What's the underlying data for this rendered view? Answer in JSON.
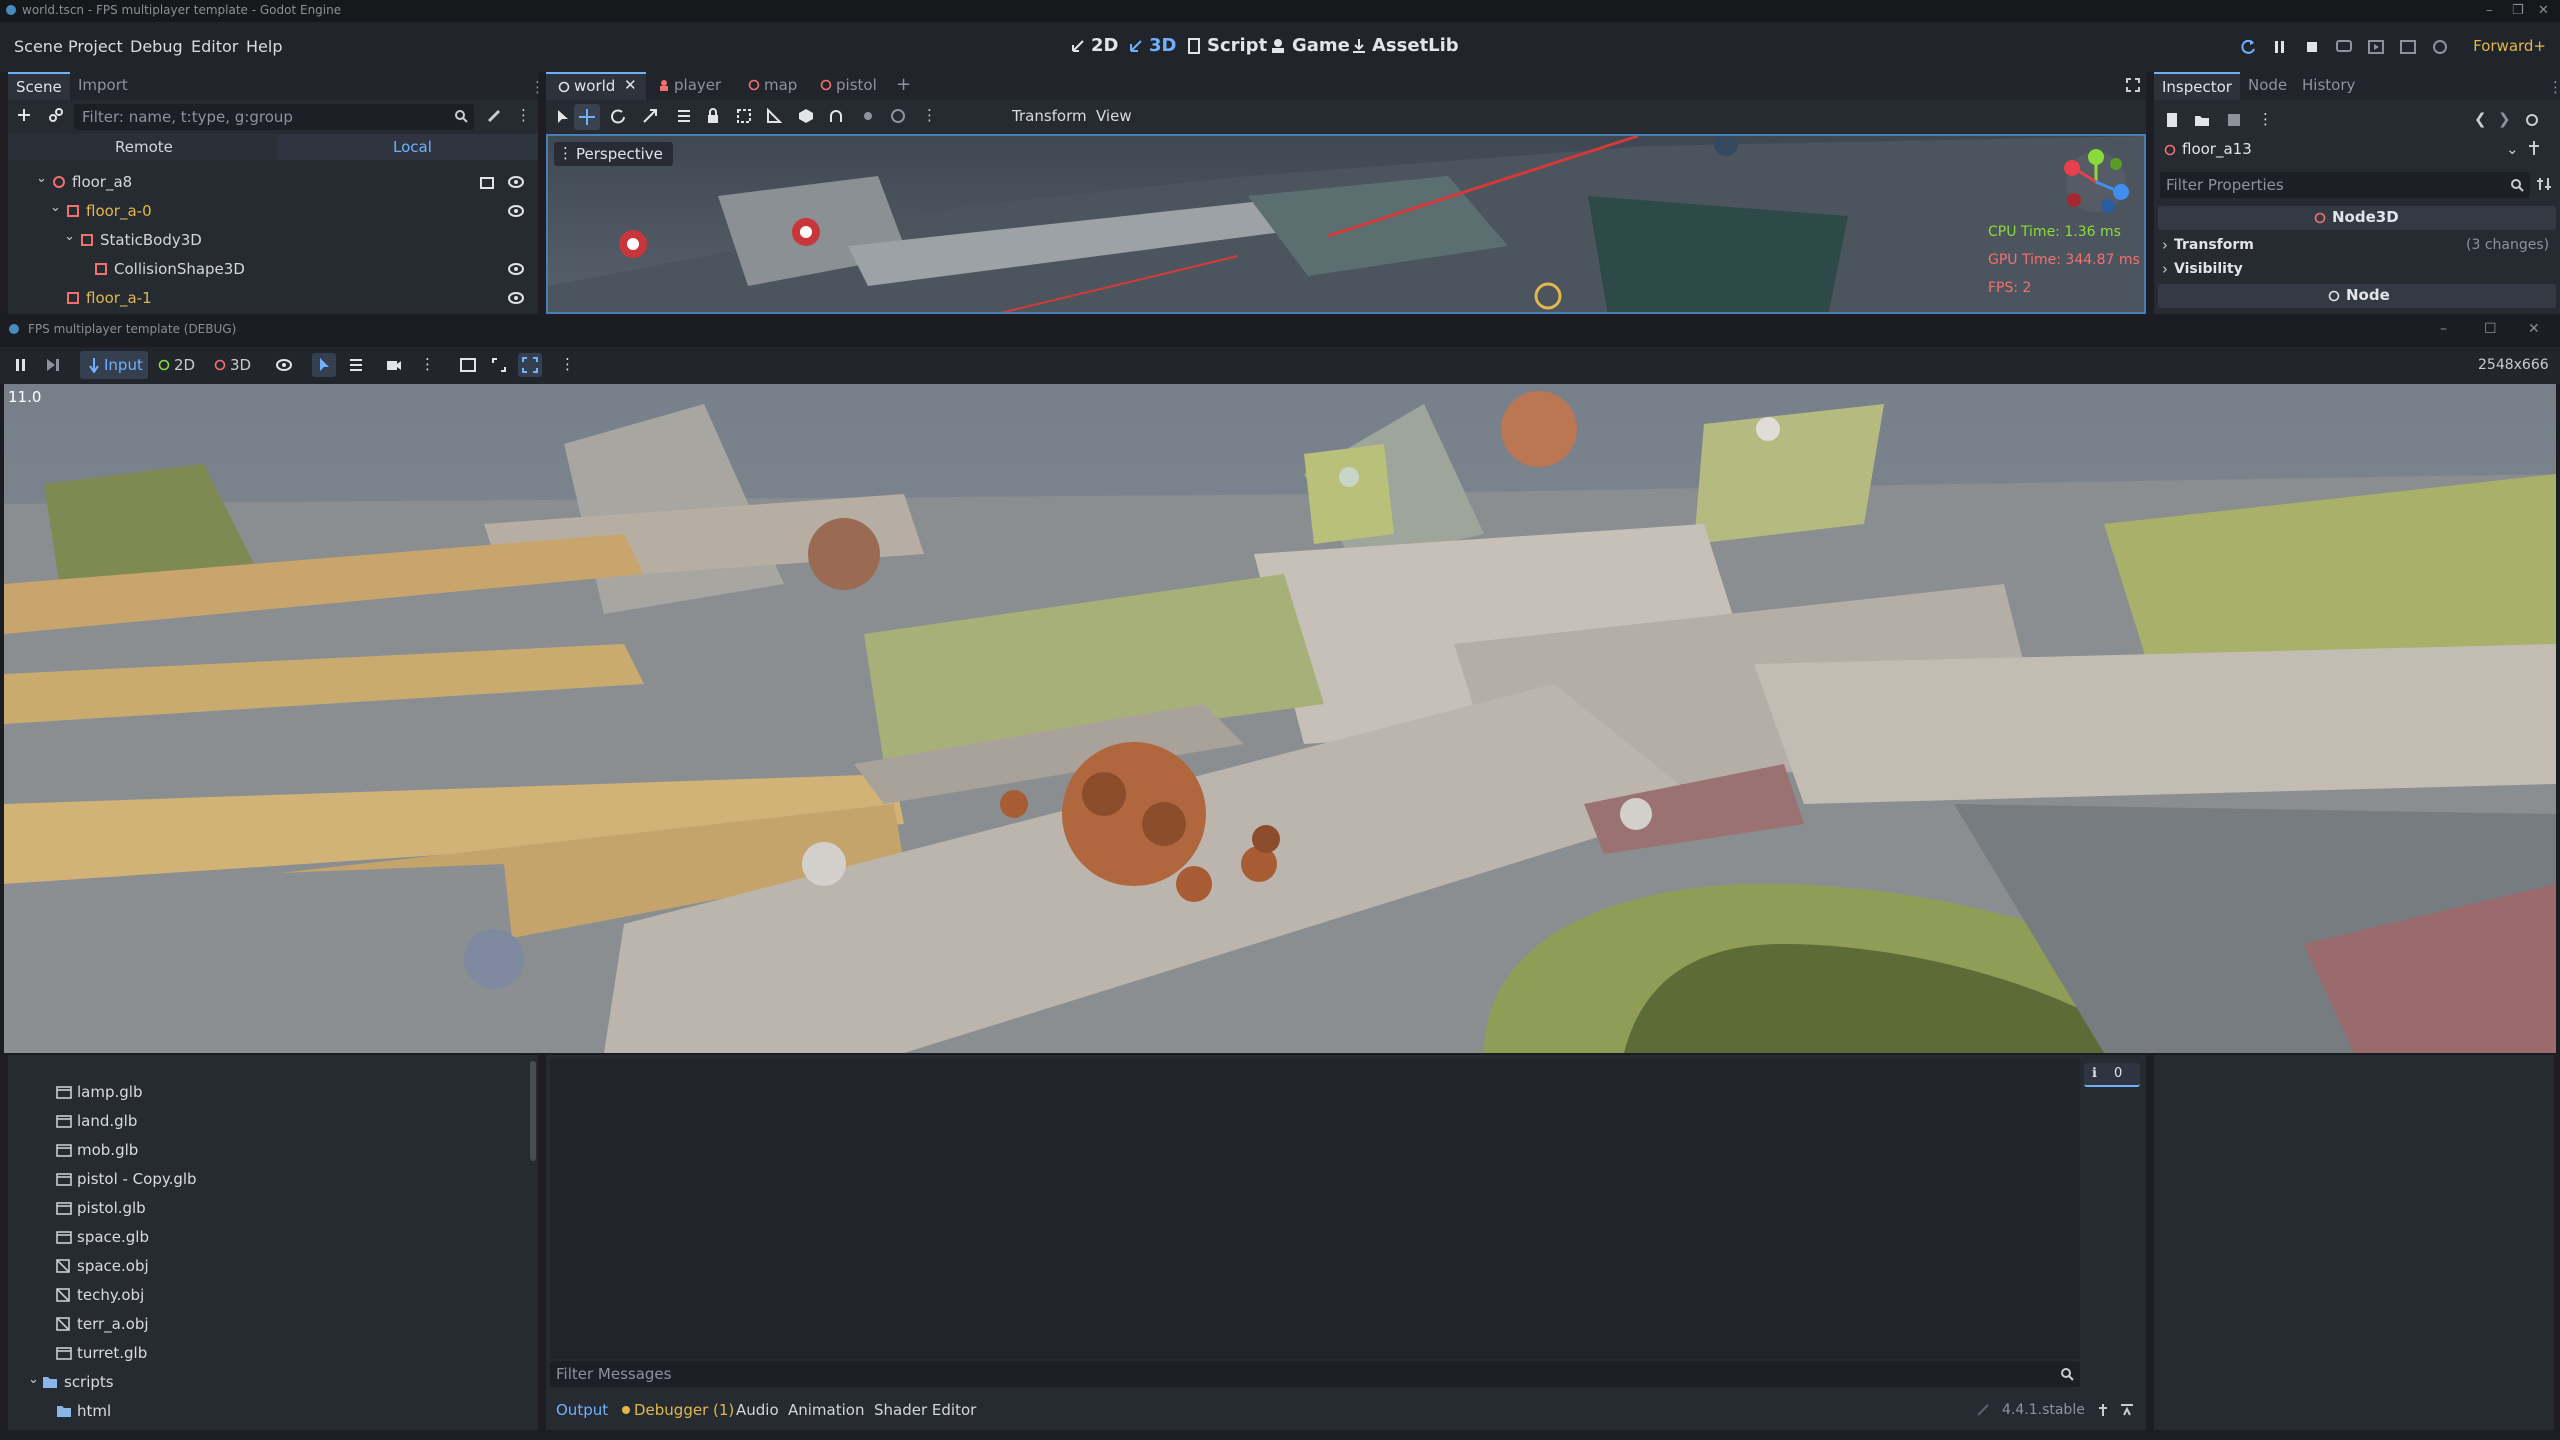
{
  "window": {
    "title": "world.tscn - FPS multiplayer template - Godot Engine",
    "controls": [
      "–",
      "❐",
      "✕"
    ]
  },
  "menu": [
    "Scene",
    "Project",
    "Debug",
    "Editor",
    "Help"
  ],
  "modes": {
    "2d": "2D",
    "3d": "3D",
    "script": "Script",
    "game": "Game",
    "assetlib": "AssetLib"
  },
  "renderer": "Forward+",
  "scene_dock": {
    "tabs": [
      "Scene",
      "Import"
    ],
    "filter_placeholder": "Filter: name, t:type, g:group",
    "remote": "Remote",
    "local": "Local",
    "tree": [
      {
        "label": "floor_a8",
        "indent": 1,
        "color": "#d4d6dc"
      },
      {
        "label": "floor_a-0",
        "indent": 2,
        "color": "#e0b84d"
      },
      {
        "label": "StaticBody3D",
        "indent": 3,
        "color": "#d4d6dc"
      },
      {
        "label": "CollisionShape3D",
        "indent": 4,
        "color": "#d4d6dc"
      },
      {
        "label": "floor_a-1",
        "indent": 2,
        "color": "#e0b84d"
      }
    ]
  },
  "editor": {
    "tabs": [
      "world",
      "player",
      "map",
      "pistol"
    ],
    "toolbar_menus": [
      "Transform",
      "View"
    ],
    "perspective": "Perspective",
    "cpu_time": "CPU Time: 1.36 ms",
    "gpu_time": "GPU Time: 344.87 ms",
    "fps": "FPS: 2"
  },
  "inspector": {
    "tabs": [
      "Inspector",
      "Node",
      "History"
    ],
    "object_name": "floor_a13",
    "filter_placeholder": "Filter Properties",
    "section_node3d": "Node3D",
    "transform": "Transform",
    "transform_changes": "(3 changes)",
    "visibility": "Visibility",
    "section_node": "Node"
  },
  "game_window": {
    "title": "FPS multiplayer template (DEBUG)",
    "input": "Input",
    "mode_2d": "2D",
    "mode_3d": "3D",
    "resolution": "2548x666",
    "fps_overlay": "11.0"
  },
  "filesystem": {
    "files": [
      {
        "label": "lamp.glb",
        "type": "scene"
      },
      {
        "label": "land.glb",
        "type": "scene"
      },
      {
        "label": "mob.glb",
        "type": "scene"
      },
      {
        "label": "pistol - Copy.glb",
        "type": "scene"
      },
      {
        "label": "pistol.glb",
        "type": "scene"
      },
      {
        "label": "space.glb",
        "type": "scene"
      },
      {
        "label": "space.obj",
        "type": "mesh"
      },
      {
        "label": "techy.obj",
        "type": "mesh"
      },
      {
        "label": "terr_a.obj",
        "type": "mesh"
      },
      {
        "label": "turret.glb",
        "type": "scene"
      }
    ],
    "folder": "scripts",
    "subfolder": "html"
  },
  "output": {
    "filter_placeholder": "Filter Messages",
    "tabs": [
      "Output",
      "Debugger (1)",
      "Audio",
      "Animation",
      "Shader Editor"
    ],
    "version": "4.4.1.stable",
    "message_count": "0"
  },
  "colors": {
    "accent": "#6fb1ff",
    "warning": "#e0b84d",
    "error": "#f27070",
    "panel": "#262a31"
  }
}
